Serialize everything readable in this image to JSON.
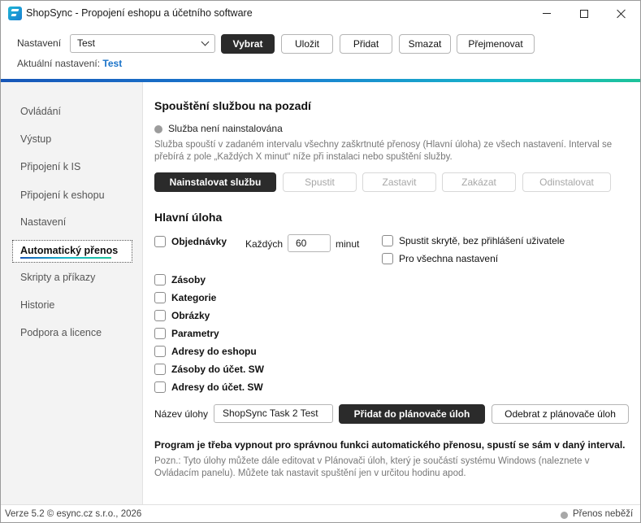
{
  "window": {
    "title": "ShopSync - Propojení eshopu a účetního software"
  },
  "settings_bar": {
    "label": "Nastavení",
    "selected": "Test",
    "buttons": {
      "select": "Vybrat",
      "save": "Uložit",
      "add": "Přidat",
      "delete": "Smazat",
      "rename": "Přejmenovat"
    },
    "current_label": "Aktuální nastavení:",
    "current_value": "Test"
  },
  "sidebar": {
    "items": [
      "Ovládání",
      "Výstup",
      "Připojení k IS",
      "Připojení k eshopu",
      "Nastavení",
      "Automatický přenos",
      "Skripty a příkazy",
      "Historie",
      "Podpora a licence"
    ],
    "active_index": 5
  },
  "service": {
    "heading": "Spouštění službou na pozadí",
    "status": "Služba není nainstalována",
    "description": "Služba spouští v zadaném intervalu všechny zaškrtnuté přenosy (Hlavní úloha) ze všech nastavení. Interval se přebírá z pole „Každých X minut“ níže při instalaci nebo spuštění služby.",
    "buttons": {
      "install": "Nainstalovat službu",
      "start": "Spustit",
      "stop": "Zastavit",
      "disable": "Zakázat",
      "uninstall": "Odinstalovat"
    }
  },
  "main_task": {
    "heading": "Hlavní úloha",
    "every_label": "Každých",
    "interval_value": "60",
    "interval_unit": "minut",
    "options": {
      "run_hidden": "Spustit skrytě, bez přihlášení uživatele",
      "all_settings": "Pro všechna nastavení"
    },
    "checkboxes": [
      "Objednávky",
      "Zásoby",
      "Kategorie",
      "Obrázky",
      "Parametry",
      "Adresy do eshopu",
      "Zásoby do účet. SW",
      "Adresy do účet. SW"
    ],
    "task_name_label": "Název úlohy",
    "task_name_value": "ShopSync Task 2 Test",
    "add_to_scheduler": "Přidat do plánovače úloh",
    "remove_from_scheduler": "Odebrat z plánovače úloh"
  },
  "notes": {
    "bold": "Program je třeba vypnout pro správnou funkci automatického přenosu, spustí se sám v daný interval.",
    "text": "Pozn.: Tyto úlohy můžete dále editovat v Plánovači úloh, který je součástí systému Windows (naleznete v Ovládacím panelu). Můžete tak nastavit spuštění jen v určitou hodinu apod."
  },
  "statusbar": {
    "version": "Verze 5.2  © esync.cz s.r.o., 2026",
    "transfer_status": "Přenos neběží"
  }
}
